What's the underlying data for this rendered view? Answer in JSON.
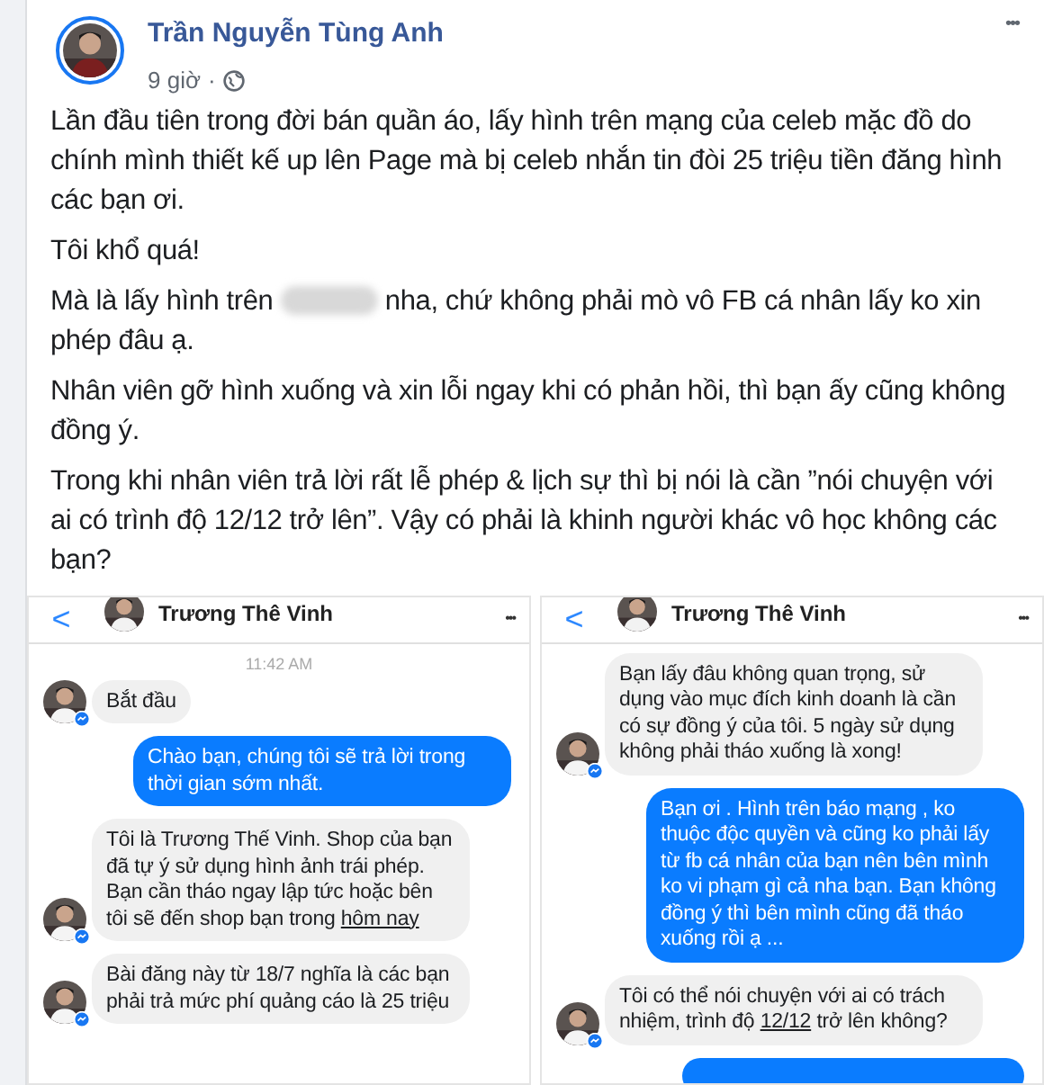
{
  "post": {
    "author": "Trần Nguyễn Tùng Anh",
    "time": "9 giờ",
    "separator": "·",
    "more": "•••",
    "paragraphs": [
      {
        "kind": "plain",
        "text": "Lần đầu tiên trong đời bán quần áo, lấy hình trên mạng của celeb mặc đồ do chính mình thiết kế up lên Page mà bị celeb nhắn tin đòi 25 triệu tiền đăng hình các bạn ơi."
      },
      {
        "kind": "plain",
        "text": "Tôi khổ quá!"
      },
      {
        "kind": "redacted",
        "text": "Mà là lấy hình trên",
        "after": "nha, chứ không phải mò vô FB cá nhân lấy ko xin phép đâu ạ."
      },
      {
        "kind": "plain",
        "text": "Nhân viên gỡ hình xuống và xin lỗi ngay khi có phản hồi, thì bạn ấy cũng không đồng ý."
      },
      {
        "kind": "plain",
        "text": "Trong khi nhân viên trả lời rất lễ phép & lịch sự thì bị nói là cần ”nói chuyện với ai có trình độ 12/12 trở lên”. Vậy có phải là khinh người khác vô học không các bạn?"
      }
    ]
  },
  "chats": [
    {
      "back": "<",
      "name": "Trương Thê Vinh",
      "more": "•••",
      "time": "11:42 AM",
      "messages": [
        {
          "kind": "incoming",
          "text": "Bắt đầu"
        },
        {
          "kind": "outgoing",
          "text": "Chào bạn, chúng tôi sẽ trả lời trong thời gian sớm nhất."
        },
        {
          "kind": "incoming",
          "text": "Tôi là Trương Thế Vinh. Shop của bạn đã tự ý sử dụng hình ảnh trái phép.\nBạn cần tháo ngay lập tức hoặc bên tôi sẽ đến shop bạn trong ",
          "underlined": "hôm nay"
        },
        {
          "kind": "incoming",
          "text": "Bài đăng này từ 18/7 nghĩa là các bạn phải trả mức phí quảng cáo là 25 triệu"
        }
      ]
    },
    {
      "back": "<",
      "name": "Trương Thê Vinh",
      "more": "•••",
      "messages": [
        {
          "kind": "incoming",
          "text": "Bạn lấy đâu không quan trọng, sử dụng vào mục đích kinh doanh là cần có sự đồng ý của tôi. 5 ngày sử dụng không phải tháo xuống là xong!"
        },
        {
          "kind": "outgoing",
          "text": "Bạn ơi . Hình trên báo mạng , ko thuộc độc quyền và cũng ko phải lấy từ fb cá nhân của bạn nên bên mình ko vi phạm gì cả nha bạn. Bạn không đồng ý thì bên mình cũng đã tháo xuống rồi ạ ..."
        },
        {
          "kind": "incoming",
          "text": "Tôi có thể nói chuyện với ai có trách nhiệm, trình độ ",
          "underlined": "12/12",
          "after": " trở lên không?"
        },
        {
          "kind": "outgoing_cut"
        }
      ]
    }
  ]
}
